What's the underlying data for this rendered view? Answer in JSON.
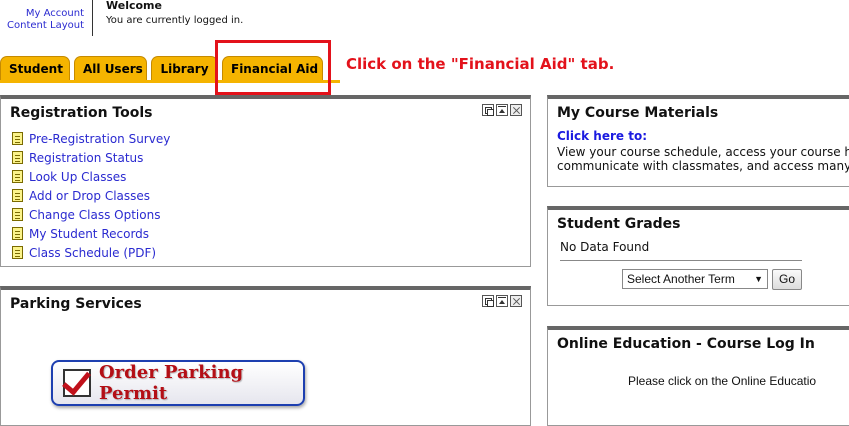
{
  "header": {
    "my_account": "My Account",
    "content_layout": "Content Layout",
    "welcome_title": "Welcome",
    "welcome_message": "You are currently logged in."
  },
  "tabs": [
    {
      "label": "Student"
    },
    {
      "label": "All Users"
    },
    {
      "label": "Library"
    },
    {
      "label": "Financial Aid"
    }
  ],
  "annotation": {
    "instruction": "Click on the \"Financial Aid\" tab.",
    "highlight_color": "#e3121b"
  },
  "registration_tools": {
    "title": "Registration Tools",
    "links": [
      {
        "label": "Pre-Registration Survey"
      },
      {
        "label": "Registration Status"
      },
      {
        "label": "Look Up Classes"
      },
      {
        "label": "Add or Drop Classes"
      },
      {
        "label": "Change Class Options"
      },
      {
        "label": "My Student Records"
      },
      {
        "label": "Class Schedule (PDF)"
      }
    ]
  },
  "parking_services": {
    "title": "Parking Services",
    "button_label": "Order Parking Permit"
  },
  "course_materials": {
    "title": "My Course Materials",
    "link": "Click here to:",
    "description_line1": "View your course schedule, access your course he",
    "description_line2": "communicate with classmates, and access many"
  },
  "student_grades": {
    "title": "Student Grades",
    "empty_message": "No Data Found",
    "term_select_value": "Select Another Term",
    "go_label": "Go"
  },
  "online_education": {
    "title": "Online Education - Course Log In",
    "text": "Please click on the Online Educatio"
  },
  "colors": {
    "tab_yellow": "#f5b400",
    "link_blue": "#2a2ad0",
    "accent_red": "#e3121b"
  }
}
